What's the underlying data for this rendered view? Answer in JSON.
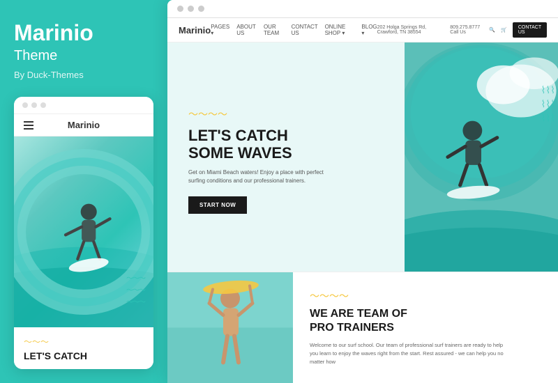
{
  "left": {
    "brand_title": "Marinio",
    "brand_subtitle": "Theme",
    "brand_author": "By Duck-Themes",
    "mobile_logo": "Marinio",
    "mobile_hero_text_line1": "LET'S CATCH"
  },
  "right": {
    "browser_dots": [
      "dot1",
      "dot2",
      "dot3"
    ],
    "nav": {
      "logo": "Marinio",
      "links": [
        "PAGES ▾",
        "ABOUT US",
        "OUR TEAM",
        "CONTACT US",
        "ONLINE SHOP ▾",
        "BLOG ▾"
      ],
      "address": "202 Holga Springs Rd, Crawford, TN 38554",
      "phone": "809.275.8777 Call Us",
      "contact_btn": "CONTACT US"
    },
    "hero": {
      "title_line1": "LET'S CATCH",
      "title_line2": "SOME WAVES",
      "description": "Get on Miami Beach waters! Enjoy a place with perfect surfing conditions and our professional trainers.",
      "cta_button": "START NOW"
    },
    "section2": {
      "title_line1": "WE ARE TEAM OF",
      "title_line2": "PRO TRAINERS",
      "description": "Welcome to our surf school. Our team of professional surf trainers are ready to help you learn to enjoy the waves right from the start. Rest assured - we can help you no matter how"
    }
  },
  "colors": {
    "teal": "#2ec4b6",
    "dark": "#1a1a1a",
    "yellow": "#f5c842",
    "white": "#ffffff"
  }
}
